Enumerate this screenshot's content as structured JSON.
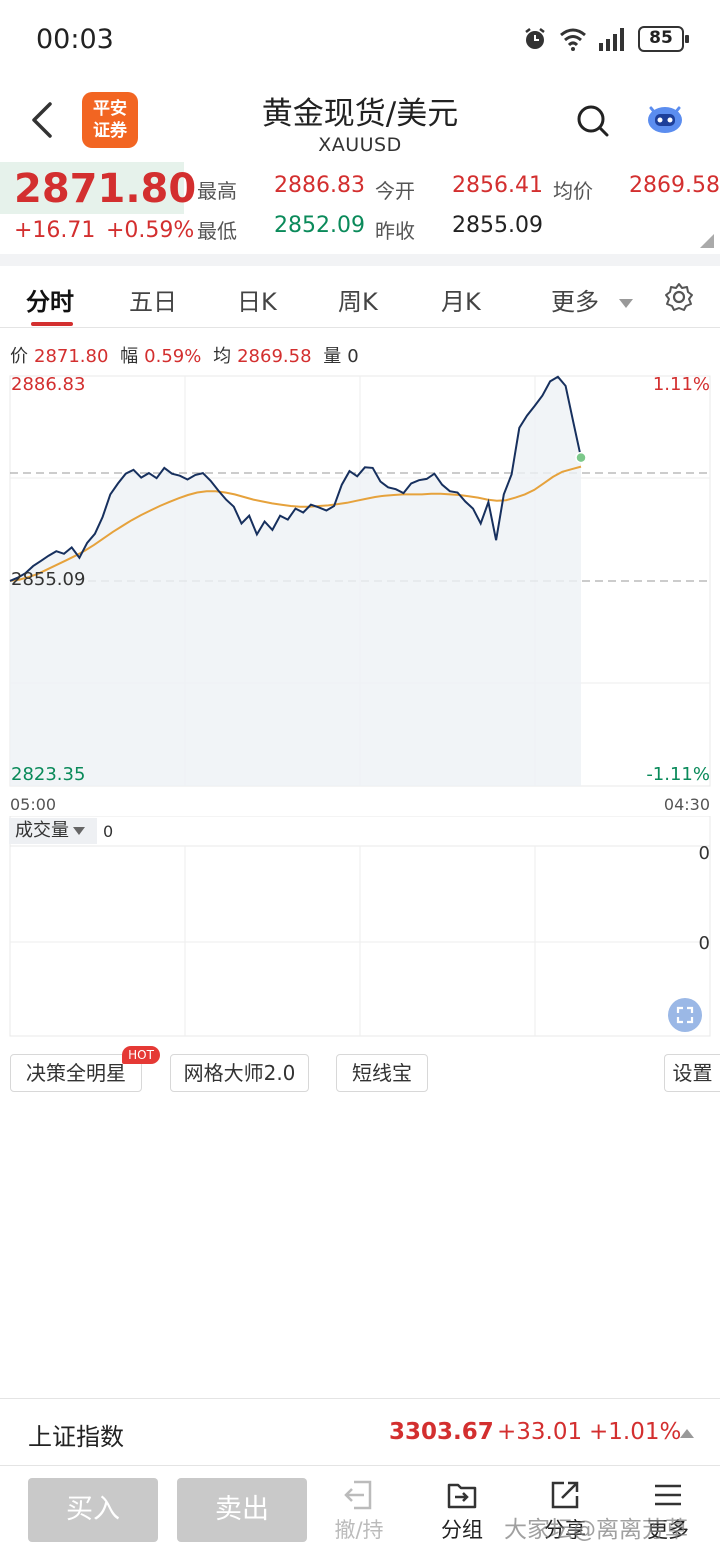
{
  "status": {
    "time": "00:03",
    "battery": "85"
  },
  "header": {
    "logo_text": "平安\n证券",
    "title": "黄金现货/美元",
    "subtitle": "XAUUSD"
  },
  "quote": {
    "last_price": "2871.80",
    "change": "+16.71",
    "change_pct": "+0.59%",
    "high_label": "最高",
    "high": "2886.83",
    "open_label": "今开",
    "open": "2856.41",
    "avg_label": "均价",
    "avg": "2869.58",
    "low_label": "最低",
    "low": "2852.09",
    "prev_close_label": "昨收",
    "prev_close": "2855.09"
  },
  "tabs": [
    "分时",
    "五日",
    "日K",
    "周K",
    "月K",
    "更多"
  ],
  "info_line": {
    "price_label": "价",
    "price": "2871.80",
    "amp_label": "幅",
    "amp": "0.59%",
    "avg_label": "均",
    "avg": "2869.58",
    "vol_label": "量",
    "vol": "0"
  },
  "chart": {
    "y_top": "2886.83",
    "y_mid": "2855.09",
    "y_bottom": "2823.35",
    "pct_top": "1.11%",
    "pct_bottom": "-1.11%",
    "time_start": "05:00",
    "time_end": "04:30"
  },
  "volume": {
    "label": "成交量",
    "value": "0",
    "axis_top": "0",
    "axis_mid": "0"
  },
  "tools": {
    "t1": "决策全明星",
    "hot": "HOT",
    "t2": "网格大师2.0",
    "t3": "短线宝",
    "settings": "设置"
  },
  "index_bar": {
    "name": "上证指数",
    "value": "3303.67",
    "change": "+33.01",
    "change_pct": "+1.01%"
  },
  "bottom_nav": {
    "buy": "买入",
    "sell": "卖出",
    "cancel": "撤/持",
    "group": "分组",
    "share": "分享",
    "more": "更多"
  },
  "watermark": "大家坛@离离芳草",
  "chart_data": {
    "type": "line",
    "y_range": [
      2823.35,
      2886.83
    ],
    "prev_close": 2855.09,
    "x_labels": [
      "05:00",
      "04:30"
    ],
    "series": [
      {
        "values": [
          2855.1,
          2855.6,
          2856.3,
          2857.4,
          2858.2,
          2859.0,
          2859.7,
          2859.3,
          2860.3,
          2858.7,
          2861.0,
          2862.4,
          2865.0,
          2868.5,
          2870.2,
          2871.7,
          2872.3,
          2871.1,
          2871.8,
          2871.0,
          2872.6,
          2871.7,
          2871.4,
          2870.8,
          2871.5,
          2871.8,
          2870.6,
          2869.1,
          2867.7,
          2866.6,
          2864.0,
          2865.2,
          2862.3,
          2864.3,
          2863.0,
          2865.2,
          2864.6,
          2866.3,
          2865.7,
          2866.9,
          2866.5,
          2866.0,
          2866.7,
          2870.0,
          2872.1,
          2871.3,
          2872.7,
          2872.6,
          2870.5,
          2869.6,
          2869.3,
          2868.7,
          2870.2,
          2870.7,
          2870.9,
          2871.7,
          2870.0,
          2869.0,
          2868.8,
          2867.4,
          2866.3,
          2864.0,
          2867.3,
          2861.4,
          2868.5,
          2871.6,
          2878.8,
          2880.7,
          2882.2,
          2883.8,
          2886.0,
          2886.7,
          2885.3,
          2879.7,
          2874.2
        ],
        "color": "#17305e"
      },
      {
        "values": [
          2855.1,
          2855.3,
          2855.7,
          2856.2,
          2856.9,
          2857.6,
          2858.3,
          2859.0,
          2859.8,
          2860.7,
          2861.7,
          2862.7,
          2863.6,
          2864.5,
          2865.3,
          2866.0,
          2866.7,
          2867.3,
          2867.9,
          2868.4,
          2868.8,
          2869.0,
          2869.0,
          2868.8,
          2868.5,
          2868.1,
          2867.7,
          2867.4,
          2867.1,
          2866.9,
          2866.7,
          2866.6,
          2866.6,
          2866.7,
          2866.8,
          2867.0,
          2867.2,
          2867.5,
          2867.8,
          2868.1,
          2868.3,
          2868.4,
          2868.5,
          2868.5,
          2868.5,
          2868.6,
          2868.6,
          2868.5,
          2868.4,
          2868.2,
          2868.0,
          2867.7,
          2867.5,
          2867.6,
          2868.0,
          2868.5,
          2869.2,
          2870.2,
          2871.2,
          2872.0,
          2872.4,
          2872.8
        ],
        "color": "#e6a23c"
      }
    ]
  }
}
